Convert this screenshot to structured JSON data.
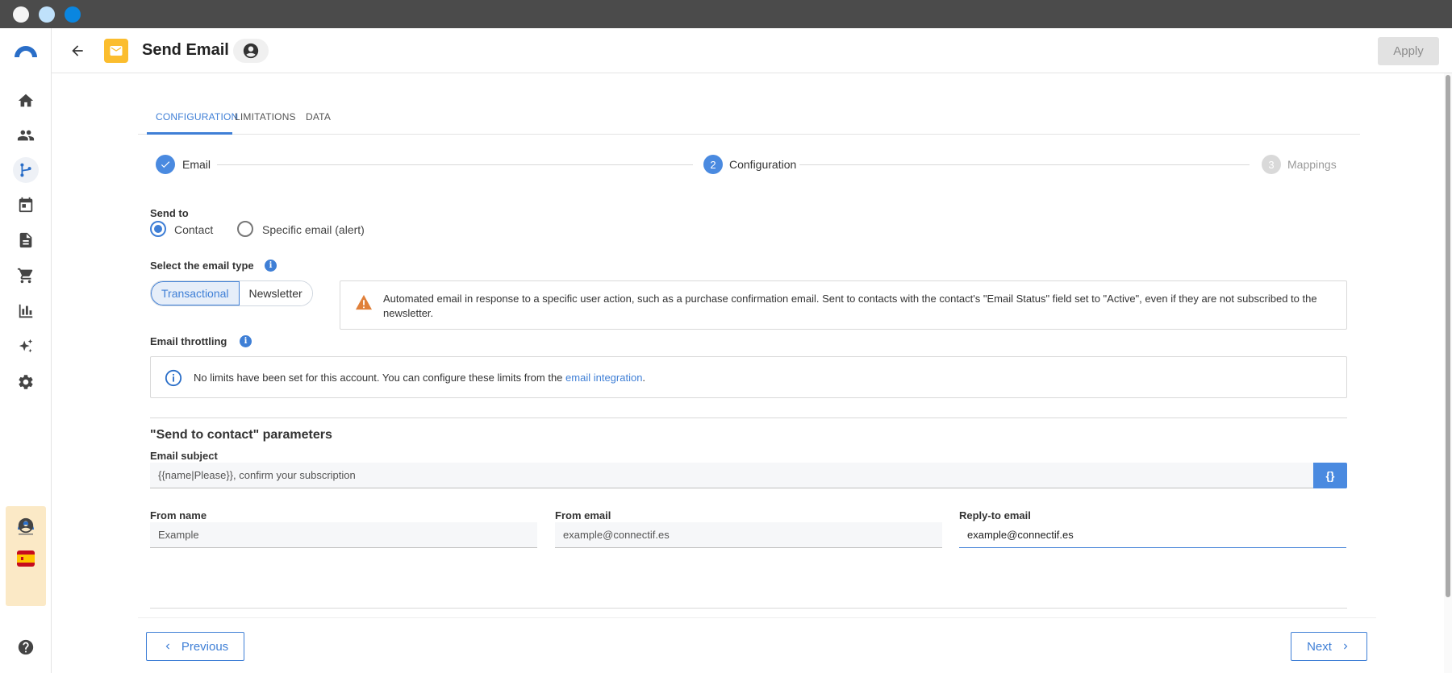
{
  "app": {
    "title": "Send Email",
    "apply_label": "Apply"
  },
  "tabs": [
    {
      "label": "CONFIGURATION"
    },
    {
      "label": "LIMITATIONS"
    },
    {
      "label": "DATA"
    }
  ],
  "stepper": {
    "steps": [
      {
        "number": "",
        "label": "Email"
      },
      {
        "number": "2",
        "label": "Configuration"
      },
      {
        "number": "3",
        "label": "Mappings"
      }
    ]
  },
  "send_to": {
    "label": "Send to",
    "options": [
      {
        "label": "Contact",
        "selected": true
      },
      {
        "label": "Specific email (alert)",
        "selected": false
      }
    ]
  },
  "email_type": {
    "label": "Select the email type",
    "options": [
      "Transactional",
      "Newsletter"
    ],
    "selected": "Transactional",
    "description": "Automated email in response to a specific user action, such as a purchase confirmation email. Sent to contacts with the contact's \"Email Status\" field set to \"Active\", even if they are not subscribed to the newsletter."
  },
  "throttling": {
    "label": "Email throttling",
    "message": "No limits have been set for this account. You can configure these limits from the ",
    "link_text": "email integration",
    "message_end": "."
  },
  "params": {
    "title": "\"Send to contact\" parameters",
    "subject_label": "Email subject",
    "subject_value": "{{name|Please}}, confirm your subscription",
    "braces_label": "{}",
    "from_name_label": "From name",
    "from_name_value": "Example",
    "from_email_label": "From email",
    "from_email_value": "example@connectif.es",
    "reply_to_label": "Reply-to email",
    "reply_to_value": "example@connectif.es"
  },
  "footer": {
    "previous_label": "Previous",
    "next_label": "Next"
  },
  "colors": {
    "accent": "#3f7fd6",
    "mail_badge": "#fbbd2e",
    "warning": "#e0803a",
    "sidebar_highlight": "#fbe9c6"
  }
}
